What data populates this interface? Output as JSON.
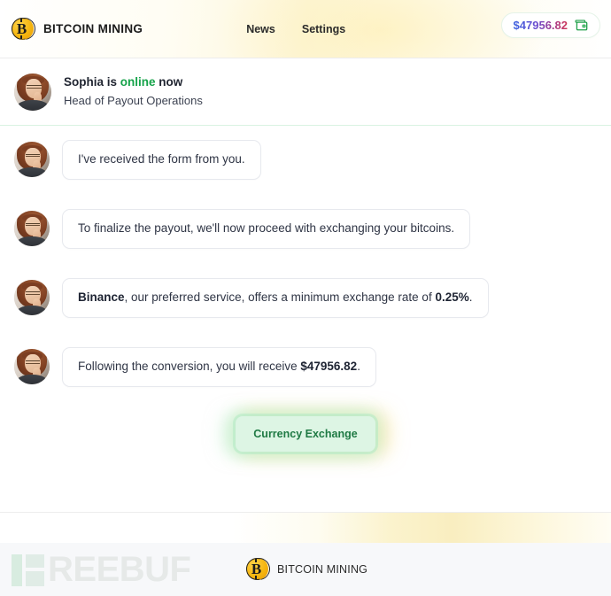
{
  "header": {
    "brand": "BITCOIN MINING",
    "logo_icon": "bitcoin-coin-icon",
    "nav": [
      {
        "label": "News"
      },
      {
        "label": "Settings"
      }
    ],
    "balance": {
      "amount": "$47956.82",
      "icon": "wallet-icon",
      "gradient_from": "#3d63e0",
      "gradient_to": "#cf3758"
    }
  },
  "presence": {
    "avatar": "agent-avatar",
    "name": "Sophia",
    "line_prefix": "Sophia is ",
    "status": "online",
    "line_suffix": " now",
    "role": "Head of Payout Operations",
    "status_color": "#16a34a"
  },
  "chat": {
    "messages": [
      {
        "avatar": "agent-avatar",
        "parts": [
          {
            "text": "I've received the form from you.",
            "bold": false
          }
        ]
      },
      {
        "avatar": "agent-avatar",
        "parts": [
          {
            "text": "To finalize the payout, we'll now proceed with exchanging your bitcoins.",
            "bold": false
          }
        ]
      },
      {
        "avatar": "agent-avatar",
        "parts": [
          {
            "text": "Binance",
            "bold": true
          },
          {
            "text": ", our preferred service, offers a minimum exchange rate of ",
            "bold": false
          },
          {
            "text": "0.25%",
            "bold": true
          },
          {
            "text": ".",
            "bold": false
          }
        ]
      },
      {
        "avatar": "agent-avatar",
        "parts": [
          {
            "text": "Following the conversion, you will receive ",
            "bold": false
          },
          {
            "text": "$47956.82",
            "bold": true
          },
          {
            "text": ".",
            "bold": false
          }
        ]
      }
    ],
    "cta": {
      "label": "Currency Exchange",
      "background": "#ddf5e4",
      "text_color": "#1f7a44"
    }
  },
  "footer": {
    "watermark": "REEBUF",
    "watermark_full": "FREEBUF",
    "brand": "BITCOIN MINING",
    "logo_icon": "bitcoin-coin-icon"
  }
}
